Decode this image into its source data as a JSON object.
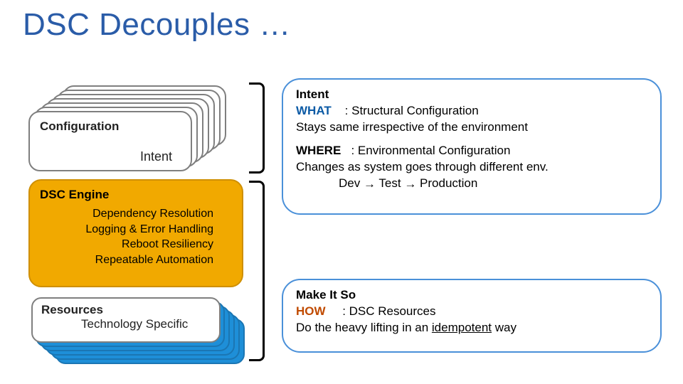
{
  "title": "DSC Decouples …",
  "config": {
    "label": "Configuration",
    "intent": "Intent"
  },
  "engine": {
    "title": "DSC Engine",
    "lines": [
      "Dependency Resolution",
      "Logging & Error Handling",
      "Reboot Resiliency",
      "Repeatable Automation"
    ]
  },
  "resources": {
    "label": "Resources",
    "sub": "Technology Specific"
  },
  "intent_bubble": {
    "hdr": "Intent",
    "what_key": "WHAT",
    "what_line": ": Structural Configuration",
    "what_line2": "Stays same irrespective of the environment",
    "where_key": "WHERE",
    "where_line": ": Environmental Configuration",
    "where_line2": "Changes as system goes through different env.",
    "where_chain_prefix": "Dev",
    "where_chain_mid": "Test",
    "where_chain_end": "Production"
  },
  "howto_bubble": {
    "hdr": "Make It So",
    "how_key": "HOW",
    "how_line": ": DSC Resources",
    "how_line2a": "Do the heavy lifting in an ",
    "how_line2b": "idempotent",
    "how_line2c": " way"
  },
  "icons": {
    "arrow": "→"
  },
  "page": ""
}
